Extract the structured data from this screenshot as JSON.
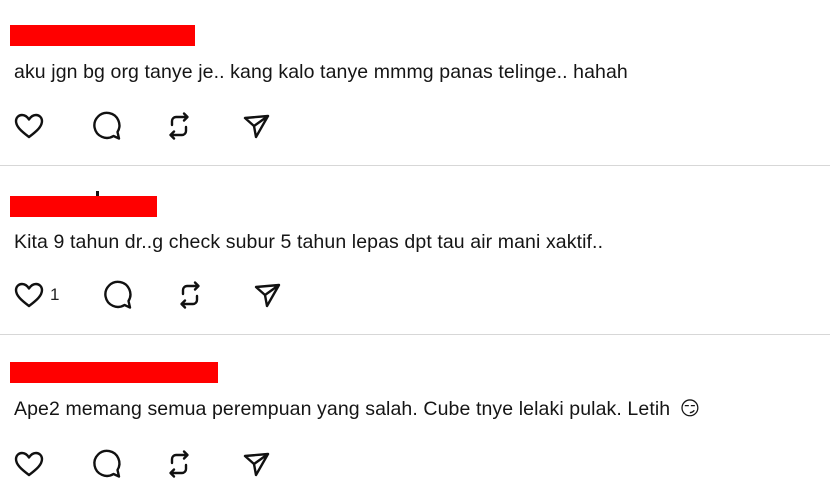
{
  "comments": [
    {
      "text": "aku jgn bg org tanye je.. kang kalo tanye mmmg panas telinge.. hahah",
      "like_count": ""
    },
    {
      "text": "Kita 9 tahun dr..g check subur 5 tahun lepas dpt tau air mani xaktif..",
      "like_count": "1"
    },
    {
      "text": "Ape2 memang semua perempuan yang salah. Cube tnye lelaki pulak. Letih",
      "emoji": "😏",
      "like_count": ""
    }
  ],
  "icons": {
    "like": "heart-icon",
    "reply": "comment-bubble-icon",
    "repost": "repost-icon",
    "share": "send-icon"
  },
  "colors": {
    "redaction": "#ff0000",
    "divider": "#d7d7d7",
    "text": "#151515",
    "icon": "#111111"
  }
}
